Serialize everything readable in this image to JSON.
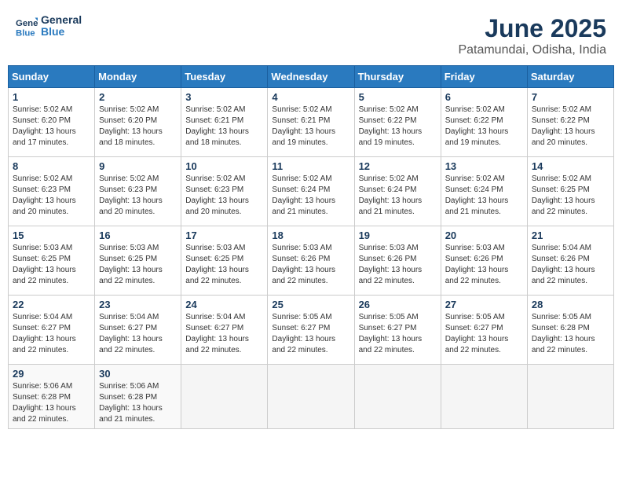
{
  "header": {
    "logo_line1": "General",
    "logo_line2": "Blue",
    "title": "June 2025",
    "subtitle": "Patamundai, Odisha, India"
  },
  "calendar": {
    "headers": [
      "Sunday",
      "Monday",
      "Tuesday",
      "Wednesday",
      "Thursday",
      "Friday",
      "Saturday"
    ],
    "weeks": [
      [
        {
          "day": "1",
          "info": "Sunrise: 5:02 AM\nSunset: 6:20 PM\nDaylight: 13 hours\nand 17 minutes."
        },
        {
          "day": "2",
          "info": "Sunrise: 5:02 AM\nSunset: 6:20 PM\nDaylight: 13 hours\nand 18 minutes."
        },
        {
          "day": "3",
          "info": "Sunrise: 5:02 AM\nSunset: 6:21 PM\nDaylight: 13 hours\nand 18 minutes."
        },
        {
          "day": "4",
          "info": "Sunrise: 5:02 AM\nSunset: 6:21 PM\nDaylight: 13 hours\nand 19 minutes."
        },
        {
          "day": "5",
          "info": "Sunrise: 5:02 AM\nSunset: 6:22 PM\nDaylight: 13 hours\nand 19 minutes."
        },
        {
          "day": "6",
          "info": "Sunrise: 5:02 AM\nSunset: 6:22 PM\nDaylight: 13 hours\nand 19 minutes."
        },
        {
          "day": "7",
          "info": "Sunrise: 5:02 AM\nSunset: 6:22 PM\nDaylight: 13 hours\nand 20 minutes."
        }
      ],
      [
        {
          "day": "8",
          "info": "Sunrise: 5:02 AM\nSunset: 6:23 PM\nDaylight: 13 hours\nand 20 minutes."
        },
        {
          "day": "9",
          "info": "Sunrise: 5:02 AM\nSunset: 6:23 PM\nDaylight: 13 hours\nand 20 minutes."
        },
        {
          "day": "10",
          "info": "Sunrise: 5:02 AM\nSunset: 6:23 PM\nDaylight: 13 hours\nand 20 minutes."
        },
        {
          "day": "11",
          "info": "Sunrise: 5:02 AM\nSunset: 6:24 PM\nDaylight: 13 hours\nand 21 minutes."
        },
        {
          "day": "12",
          "info": "Sunrise: 5:02 AM\nSunset: 6:24 PM\nDaylight: 13 hours\nand 21 minutes."
        },
        {
          "day": "13",
          "info": "Sunrise: 5:02 AM\nSunset: 6:24 PM\nDaylight: 13 hours\nand 21 minutes."
        },
        {
          "day": "14",
          "info": "Sunrise: 5:02 AM\nSunset: 6:25 PM\nDaylight: 13 hours\nand 22 minutes."
        }
      ],
      [
        {
          "day": "15",
          "info": "Sunrise: 5:03 AM\nSunset: 6:25 PM\nDaylight: 13 hours\nand 22 minutes."
        },
        {
          "day": "16",
          "info": "Sunrise: 5:03 AM\nSunset: 6:25 PM\nDaylight: 13 hours\nand 22 minutes."
        },
        {
          "day": "17",
          "info": "Sunrise: 5:03 AM\nSunset: 6:25 PM\nDaylight: 13 hours\nand 22 minutes."
        },
        {
          "day": "18",
          "info": "Sunrise: 5:03 AM\nSunset: 6:26 PM\nDaylight: 13 hours\nand 22 minutes."
        },
        {
          "day": "19",
          "info": "Sunrise: 5:03 AM\nSunset: 6:26 PM\nDaylight: 13 hours\nand 22 minutes."
        },
        {
          "day": "20",
          "info": "Sunrise: 5:03 AM\nSunset: 6:26 PM\nDaylight: 13 hours\nand 22 minutes."
        },
        {
          "day": "21",
          "info": "Sunrise: 5:04 AM\nSunset: 6:26 PM\nDaylight: 13 hours\nand 22 minutes."
        }
      ],
      [
        {
          "day": "22",
          "info": "Sunrise: 5:04 AM\nSunset: 6:27 PM\nDaylight: 13 hours\nand 22 minutes."
        },
        {
          "day": "23",
          "info": "Sunrise: 5:04 AM\nSunset: 6:27 PM\nDaylight: 13 hours\nand 22 minutes."
        },
        {
          "day": "24",
          "info": "Sunrise: 5:04 AM\nSunset: 6:27 PM\nDaylight: 13 hours\nand 22 minutes."
        },
        {
          "day": "25",
          "info": "Sunrise: 5:05 AM\nSunset: 6:27 PM\nDaylight: 13 hours\nand 22 minutes."
        },
        {
          "day": "26",
          "info": "Sunrise: 5:05 AM\nSunset: 6:27 PM\nDaylight: 13 hours\nand 22 minutes."
        },
        {
          "day": "27",
          "info": "Sunrise: 5:05 AM\nSunset: 6:27 PM\nDaylight: 13 hours\nand 22 minutes."
        },
        {
          "day": "28",
          "info": "Sunrise: 5:05 AM\nSunset: 6:28 PM\nDaylight: 13 hours\nand 22 minutes."
        }
      ],
      [
        {
          "day": "29",
          "info": "Sunrise: 5:06 AM\nSunset: 6:28 PM\nDaylight: 13 hours\nand 22 minutes."
        },
        {
          "day": "30",
          "info": "Sunrise: 5:06 AM\nSunset: 6:28 PM\nDaylight: 13 hours\nand 21 minutes."
        },
        {
          "day": "",
          "info": ""
        },
        {
          "day": "",
          "info": ""
        },
        {
          "day": "",
          "info": ""
        },
        {
          "day": "",
          "info": ""
        },
        {
          "day": "",
          "info": ""
        }
      ]
    ]
  }
}
